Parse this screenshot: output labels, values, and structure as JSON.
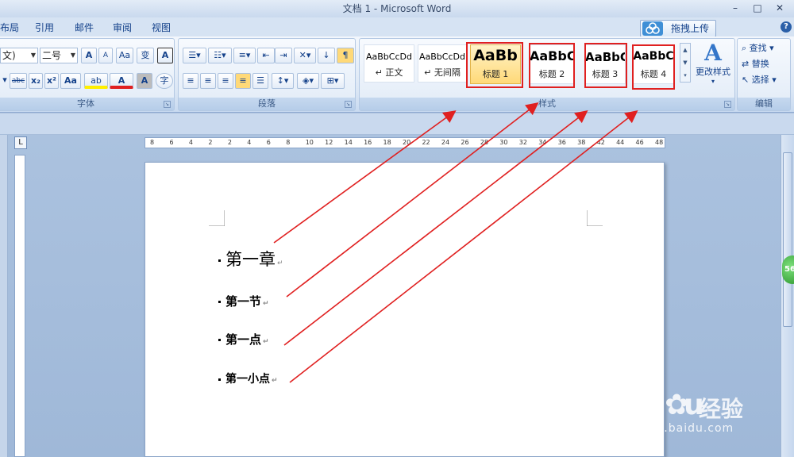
{
  "window": {
    "title": "文档 1 - Microsoft Word",
    "upload_button": "拖拽上传",
    "help": "?"
  },
  "menu": {
    "tabs": [
      "布局",
      "引用",
      "邮件",
      "审阅",
      "视图"
    ]
  },
  "ribbon": {
    "font_group": {
      "label": "字体",
      "font_name": "文)",
      "font_size": "二号",
      "grow": "A",
      "shrink": "A",
      "clear_format": "Aa",
      "phonetic": "变",
      "border_char": "A",
      "strike": "abc",
      "subscript": "x₂",
      "superscript": "x²",
      "change_case": "Aa",
      "highlight": "ab",
      "font_color": "A",
      "shade_char": "A",
      "enclose_char": "字"
    },
    "paragraph_group": {
      "label": "段落"
    },
    "styles_group": {
      "label": "样式",
      "styles": [
        {
          "sample": "AaBbCcDd",
          "name": "正文",
          "mark": "↵"
        },
        {
          "sample": "AaBbCcDd",
          "name": "无间隔",
          "mark": "↵"
        },
        {
          "sample": "AaBb",
          "name": "标题 1"
        },
        {
          "sample": "AaBbC",
          "name": "标题 2"
        },
        {
          "sample": "AaBbC",
          "name": "标题 3"
        },
        {
          "sample": "AaBbC",
          "name": "标题 4"
        }
      ],
      "change_styles": "更改样式"
    },
    "edit_group": {
      "label": "编辑",
      "find": "查找",
      "replace": "替换",
      "select": "选择"
    }
  },
  "ruler": {
    "ticks": [
      "8",
      "6",
      "4",
      "2",
      "2",
      "4",
      "6",
      "8",
      "10",
      "12",
      "14",
      "16",
      "18",
      "20",
      "22",
      "24",
      "26",
      "28",
      "30",
      "32",
      "34",
      "36",
      "38",
      "42",
      "44",
      "46",
      "48"
    ]
  },
  "document": {
    "headings": [
      {
        "text": "第一章",
        "level": 1
      },
      {
        "text": "第一节",
        "level": 2
      },
      {
        "text": "第一点",
        "level": 3
      },
      {
        "text": "第一小点",
        "level": 4
      }
    ],
    "paragraph_mark": "↵"
  },
  "side_badge": "56",
  "watermark": {
    "brand": "Bai",
    "brand_tail": "u",
    "product": "经验",
    "domain": "jingyan.baidu.com"
  },
  "colors": {
    "annotation": "#e02020",
    "ribbon_text": "#15428b"
  }
}
